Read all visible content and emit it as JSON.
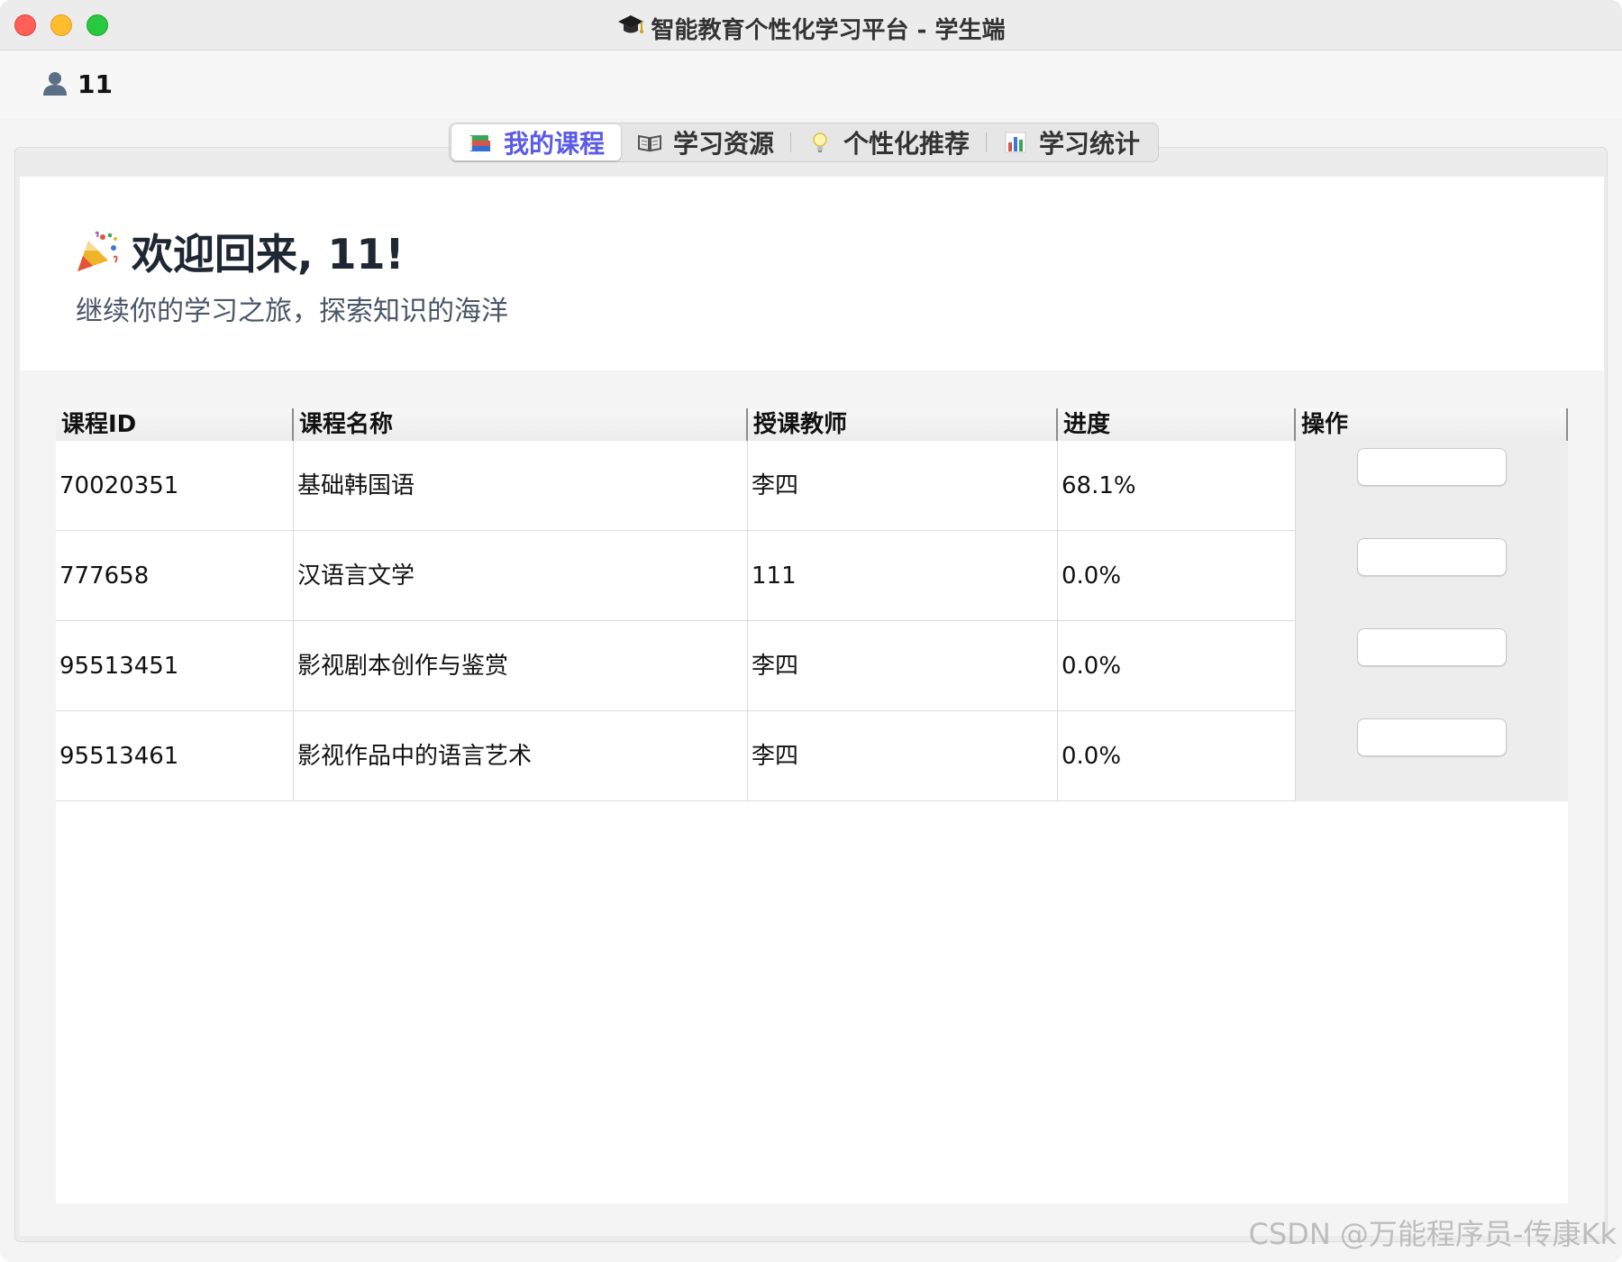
{
  "window": {
    "title": "智能教育个性化学习平台 - 学生端",
    "title_icon": "graduation-cap-icon"
  },
  "user": {
    "name": "11",
    "icon": "user-icon"
  },
  "tabs": [
    {
      "label": "我的课程",
      "icon": "books-icon",
      "active": true
    },
    {
      "label": "学习资源",
      "icon": "open-book-icon",
      "active": false
    },
    {
      "label": "个性化推荐",
      "icon": "lightbulb-icon",
      "active": false
    },
    {
      "label": "学习统计",
      "icon": "bar-chart-icon",
      "active": false
    }
  ],
  "welcome": {
    "title": "欢迎回来, 11!",
    "icon": "party-popper-icon",
    "subtitle": "继续你的学习之旅，探索知识的海洋"
  },
  "table": {
    "columns": [
      "课程ID",
      "课程名称",
      "授课教师",
      "进度",
      "操作"
    ],
    "rows": [
      {
        "id": "70020351",
        "name": "基础韩国语",
        "teacher": "李四",
        "progress": "68.1%"
      },
      {
        "id": "777658",
        "name": "汉语言文学",
        "teacher": "111",
        "progress": "0.0%"
      },
      {
        "id": "95513451",
        "name": "影视剧本创作与鉴赏",
        "teacher": "李四",
        "progress": "0.0%"
      },
      {
        "id": "95513461",
        "name": "影视作品中的语言艺术",
        "teacher": "李四",
        "progress": "0.0%"
      }
    ]
  },
  "watermark": "CSDN @万能程序员-传康Kk",
  "colors": {
    "accent": "#5b5be6",
    "close": "#fe5f57",
    "minimize": "#febc2e",
    "maximize": "#28c840"
  }
}
